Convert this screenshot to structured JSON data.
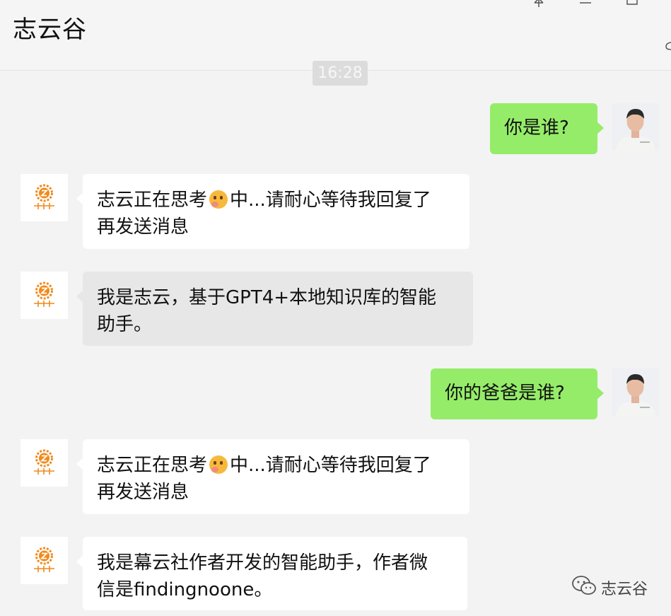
{
  "window": {
    "title": "志云谷"
  },
  "time_divider": "16:28",
  "messages": [
    {
      "sender": "me",
      "text": "你是谁?"
    },
    {
      "sender": "bot",
      "text_before_emoji": "志云正在思考",
      "emoji": "thinking-face-emoji",
      "text_after_emoji": "中...请耐心等待我回复了",
      "text_line2": "再发送消息"
    },
    {
      "sender": "bot",
      "line1": "我是志云，基于GPT4+本地知识库的智能",
      "line2": "助手。"
    },
    {
      "sender": "me",
      "text": "你的爸爸是谁?"
    },
    {
      "sender": "bot",
      "text_before_emoji": "志云正在思考",
      "emoji": "thinking-face-emoji",
      "text_after_emoji": "中...请耐心等待我回复了",
      "text_line2": "再发送消息"
    },
    {
      "sender": "bot",
      "line1": "我是幕云社作者开发的智能助手，作者微",
      "line2": "信是findingnoone。"
    }
  ],
  "bot_avatar": {
    "letter": "Z",
    "label": "志云谷"
  },
  "watermark": {
    "text": "志云谷",
    "icon": "wechat-icon"
  },
  "colors": {
    "my_bubble": "#95ec69",
    "bot_bubble": "#ffffff",
    "bot_bubble_highlight": "#e7e7e7",
    "background": "#f3f3f3",
    "logo_orange": "#f08a1c"
  }
}
